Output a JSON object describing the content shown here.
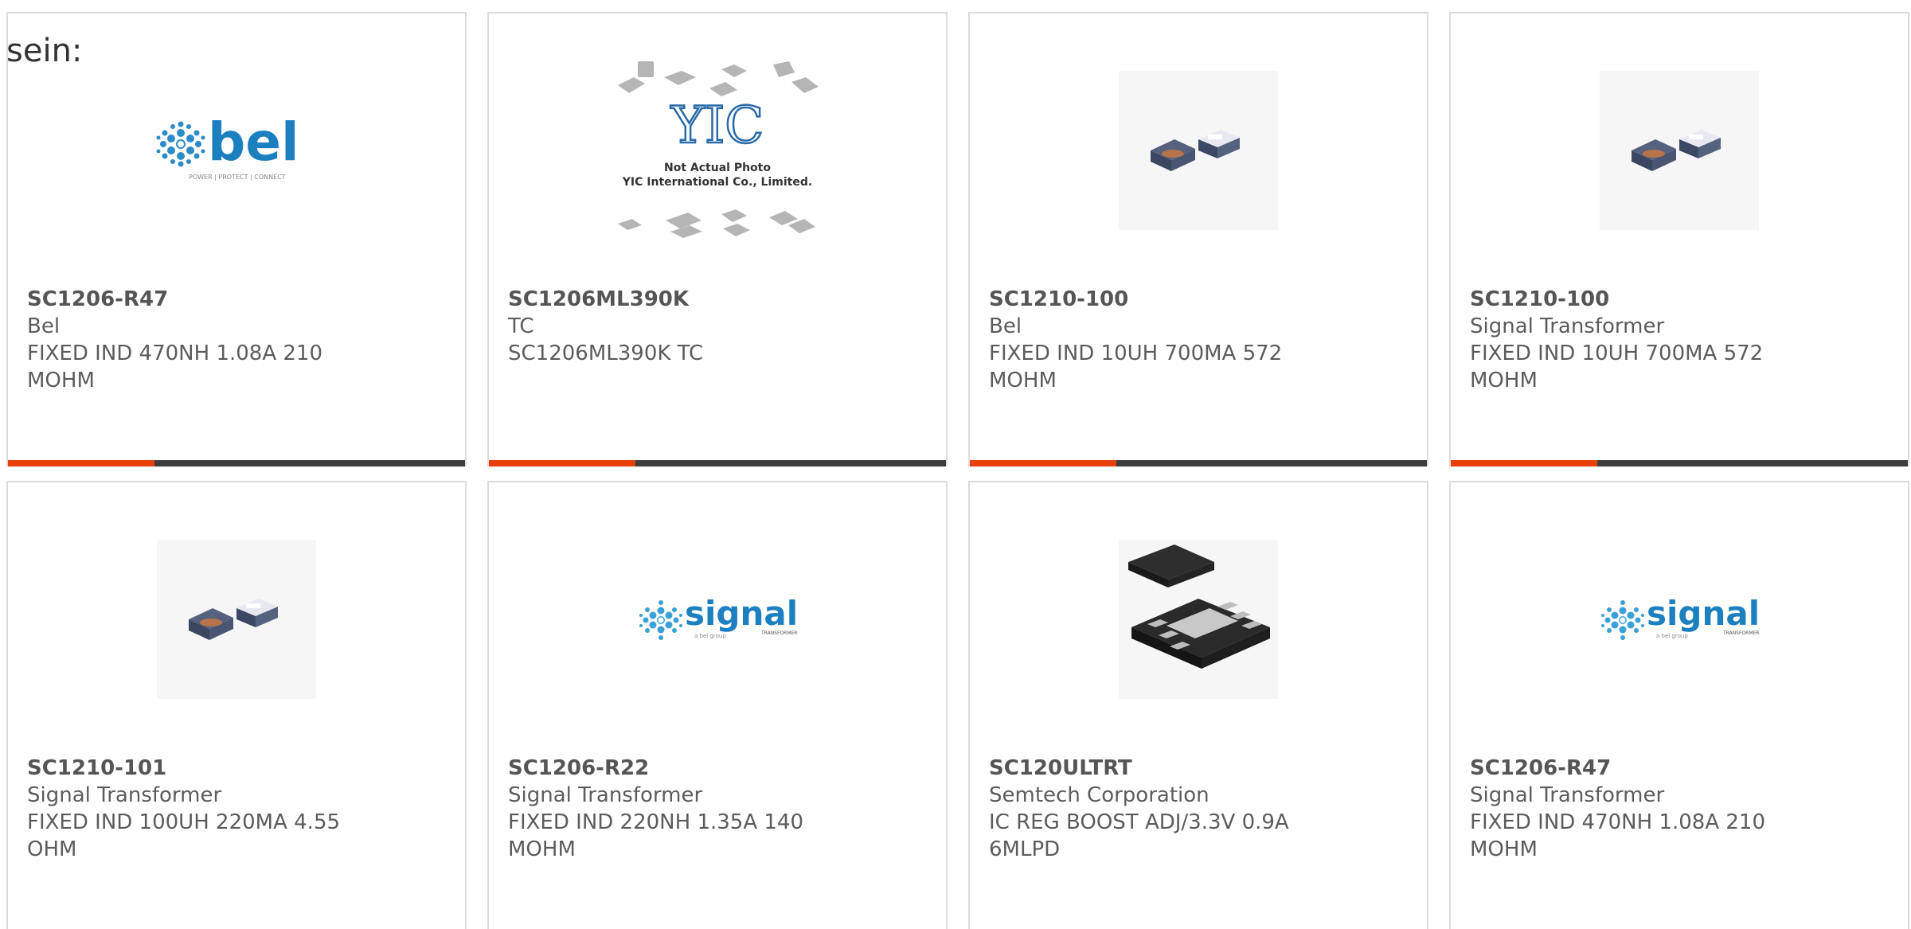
{
  "intro_text": "sein:",
  "colors": {
    "accent": "#e8400c",
    "bar": "#3d3d3d",
    "border": "#dcdcdc"
  },
  "products": [
    {
      "part": "SC1206-R47",
      "brand": "Bel",
      "desc": "FIXED IND 470NH 1.08A 210 MOHM",
      "image": "bel-logo",
      "progress_bar": true
    },
    {
      "part": "SC1206ML390K",
      "brand": "TC",
      "desc": "SC1206ML390K TC",
      "image": "yic-not-actual-photo",
      "image_text": [
        "YIC",
        "Not Actual Photo",
        "YIC International Co., Limited."
      ],
      "progress_bar": true
    },
    {
      "part": "SC1210-100",
      "brand": "Bel",
      "desc": "FIXED IND 10UH 700MA 572 MOHM",
      "image": "inductor-photo",
      "progress_bar": true
    },
    {
      "part": "SC1210-100",
      "brand": "Signal Transformer",
      "desc": "FIXED IND 10UH 700MA 572 MOHM",
      "image": "inductor-photo",
      "progress_bar": true
    },
    {
      "part": "SC1210-101",
      "brand": "Signal Transformer",
      "desc": "FIXED IND 100UH 220MA 4.55 OHM",
      "image": "inductor-photo",
      "progress_bar": false
    },
    {
      "part": "SC1206-R22",
      "brand": "Signal Transformer",
      "desc": "FIXED IND 220NH 1.35A 140 MOHM",
      "image": "signal-logo",
      "progress_bar": false
    },
    {
      "part": "SC120ULTRT",
      "brand": "Semtech Corporation",
      "desc": "IC REG BOOST ADJ/3.3V 0.9A 6MLPD",
      "image": "ic-package-photo",
      "progress_bar": false
    },
    {
      "part": "SC1206-R47",
      "brand": "Signal Transformer",
      "desc": "FIXED IND 470NH 1.08A 210 MOHM",
      "image": "signal-logo",
      "progress_bar": false
    }
  ],
  "logo_text": {
    "bel": "bel",
    "bel_tagline": "POWER | PROTECT | CONNECT",
    "signal": "signal",
    "signal_sub": "TRANSFORMER",
    "signal_group": "a bel group"
  }
}
